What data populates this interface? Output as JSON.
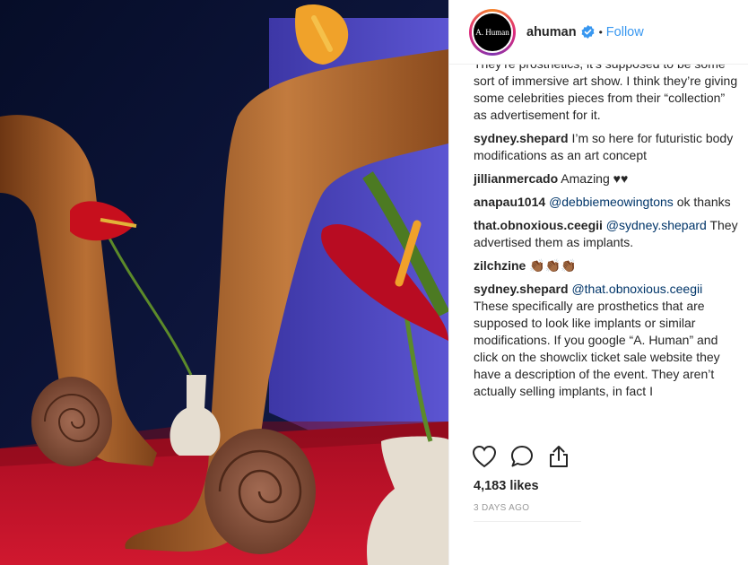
{
  "post": {
    "image_alt": "",
    "username": "ahuman",
    "avatar_text": "A. Human",
    "separator": "•",
    "follow_label": "Follow",
    "likes": "4,183 likes",
    "timestamp": "3 DAYS AGO"
  },
  "comments": [
    {
      "user": "",
      "mention": "",
      "text": "They’re prosthetics, it’s supposed to be some sort of immersive art show. I think they’re giving some celebrities pieces from their “collection” as advertisement for it."
    },
    {
      "user": "sydney.shepard",
      "mention": "",
      "text": "I’m so here for futuristic body modifications as an art concept"
    },
    {
      "user": "jillianmercado",
      "mention": "",
      "text": "Amazing ♥♥"
    },
    {
      "user": "anapau1014",
      "mention": "@debbiemeowingtons",
      "text": "ok thanks"
    },
    {
      "user": "that.obnoxious.ceegii",
      "mention": "@sydney.shepard",
      "text": "They advertised them as implants."
    },
    {
      "user": "zilchzine",
      "mention": "",
      "text": "👏🏾👏🏾👏🏾"
    },
    {
      "user": "sydney.shepard",
      "mention": "@that.obnoxious.ceegii",
      "text": "These specifically are prosthetics that are supposed to look like implants or similar modifications. If you google “A. Human” and click on the showclix ticket sale website they have a description of the event. They aren’t actually selling implants, in fact I"
    }
  ],
  "icons": {
    "verified": "verified-badge-icon",
    "like": "heart-icon",
    "comment": "comment-bubble-icon",
    "share": "share-icon"
  },
  "colors": {
    "follow": "#3897f0",
    "mention": "#003569",
    "verified": "#3897f0",
    "table": "#c0102a",
    "backdrop": "#0b1436"
  }
}
